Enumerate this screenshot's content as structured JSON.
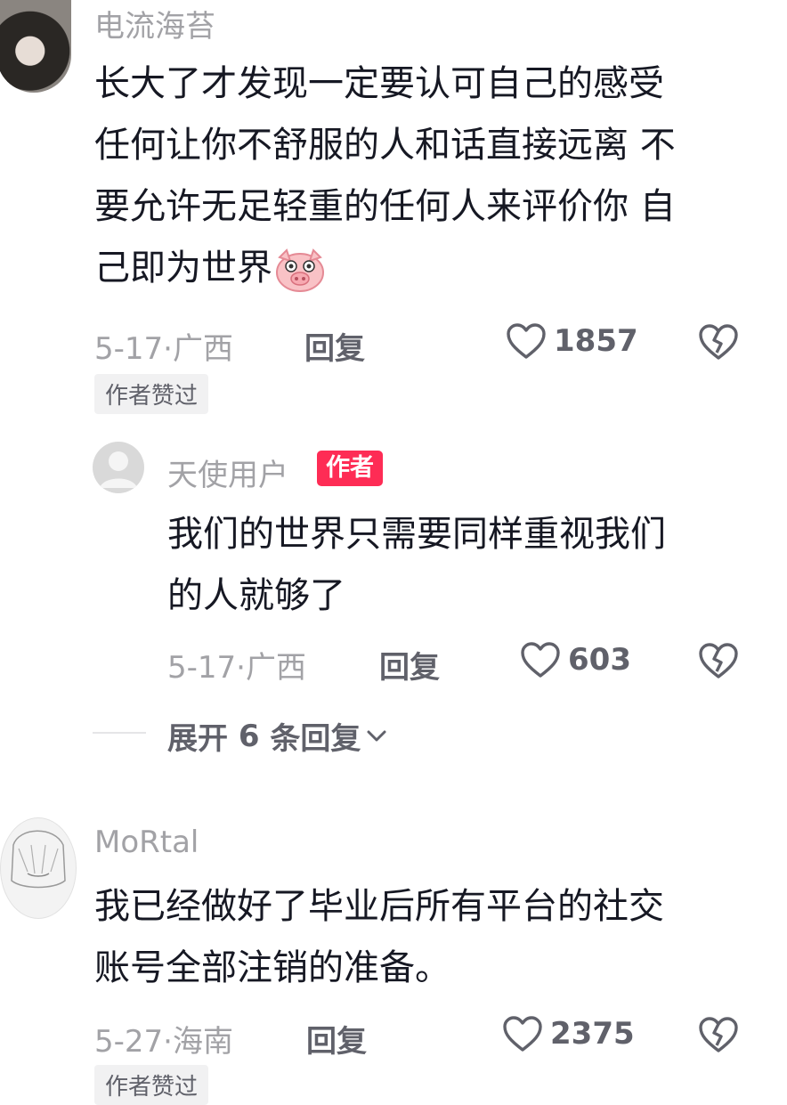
{
  "comments": [
    {
      "username": "电流海苔",
      "lines": [
        "长大了才发现一定要认可自己的感受",
        "任何让你不舒服的人和话直接远离  不",
        "要允许无足轻重的任何人来评价你 自",
        "己即为世界"
      ],
      "emoji": "pig-face",
      "date": "5-17·",
      "location": "广西",
      "reply_label": "回复",
      "likes": "1857",
      "author_liked": "作者赞过"
    },
    {
      "username": "MoRtal",
      "lines": [
        "我已经做好了毕业后所有平台的社交",
        "账号全部注销的准备。"
      ],
      "date": "5-27·",
      "location": "海南",
      "reply_label": "回复",
      "likes": "2375",
      "author_liked": "作者赞过"
    }
  ],
  "reply": {
    "username": "天使用户",
    "author_tag": "作者",
    "lines": [
      "我们的世界只需要同样重视我们",
      "的人就够了"
    ],
    "date": "5-17·",
    "location": "广西",
    "reply_label": "回复",
    "likes": "603"
  },
  "expand_replies": {
    "label_prefix": "展开 ",
    "count": "6",
    "label_suffix": " 条回复"
  },
  "colors": {
    "text": "#161823",
    "secondary": "#a2a2a6",
    "action": "#60616a",
    "author_tag": "#fe2c55"
  }
}
